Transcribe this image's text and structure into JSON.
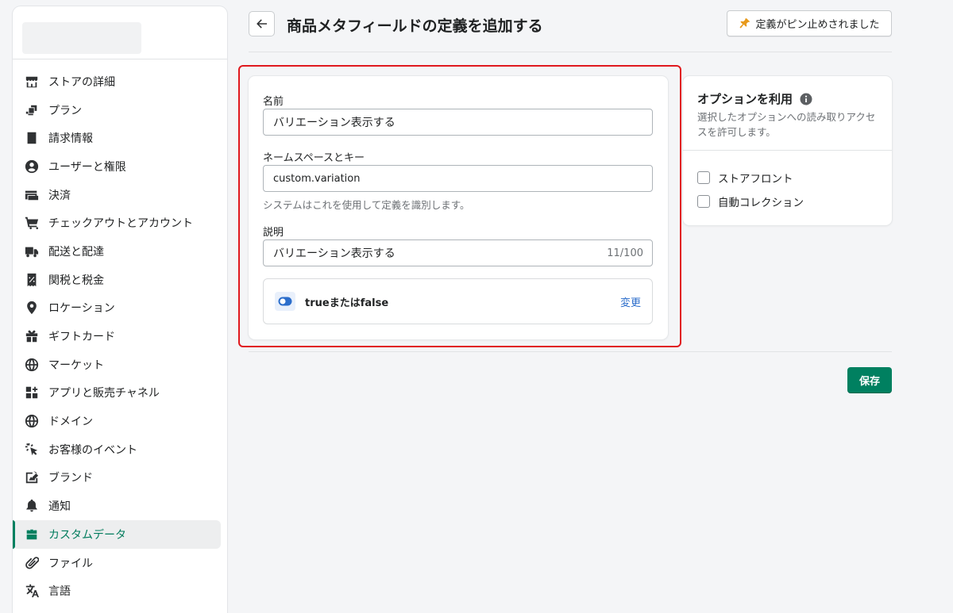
{
  "colors": {
    "accent": "#008060",
    "highlight": "#e0191e",
    "link": "#2c6ecb"
  },
  "sidebar": {
    "items": [
      {
        "label": "ストアの詳細",
        "icon": "store-icon"
      },
      {
        "label": "プラン",
        "icon": "plan-icon"
      },
      {
        "label": "請求情報",
        "icon": "billing-icon"
      },
      {
        "label": "ユーザーと権限",
        "icon": "user-icon"
      },
      {
        "label": "決済",
        "icon": "payment-card-icon"
      },
      {
        "label": "チェックアウトとアカウント",
        "icon": "cart-icon"
      },
      {
        "label": "配送と配達",
        "icon": "truck-icon"
      },
      {
        "label": "関税と税金",
        "icon": "tax-icon"
      },
      {
        "label": "ロケーション",
        "icon": "location-pin-icon"
      },
      {
        "label": "ギフトカード",
        "icon": "gift-icon"
      },
      {
        "label": "マーケット",
        "icon": "globe-icon"
      },
      {
        "label": "アプリと販売チャネル",
        "icon": "apps-icon"
      },
      {
        "label": "ドメイン",
        "icon": "domain-globe-icon"
      },
      {
        "label": "お客様のイベント",
        "icon": "cursor-click-icon"
      },
      {
        "label": "ブランド",
        "icon": "brand-icon"
      },
      {
        "label": "通知",
        "icon": "bell-icon"
      },
      {
        "label": "カスタムデータ",
        "icon": "custom-data-icon",
        "active": true
      },
      {
        "label": "ファイル",
        "icon": "paperclip-icon"
      },
      {
        "label": "言語",
        "icon": "translate-icon"
      },
      {
        "label": "",
        "icon": "more-icon"
      }
    ]
  },
  "header": {
    "title": "商品メタフィールドの定義を追加する",
    "pin_label": "定義がピン止めされました"
  },
  "form": {
    "name_label": "名前",
    "name_value": "バリエーション表示する",
    "namespace_label": "ネームスペースとキー",
    "namespace_value": "custom.variation",
    "namespace_help": "システムはこれを使用して定義を識別します。",
    "description_label": "説明",
    "description_value": "バリエーション表示する",
    "description_count": "11/100",
    "type_label": "trueまたはfalse",
    "change_label": "変更"
  },
  "options": {
    "title": "オプションを利用",
    "description": "選択したオプションへの読み取りアクセスを許可します。",
    "checkboxes": [
      {
        "label": "ストアフロント",
        "checked": false
      },
      {
        "label": "自動コレクション",
        "checked": false
      }
    ]
  },
  "footer": {
    "save_label": "保存"
  }
}
